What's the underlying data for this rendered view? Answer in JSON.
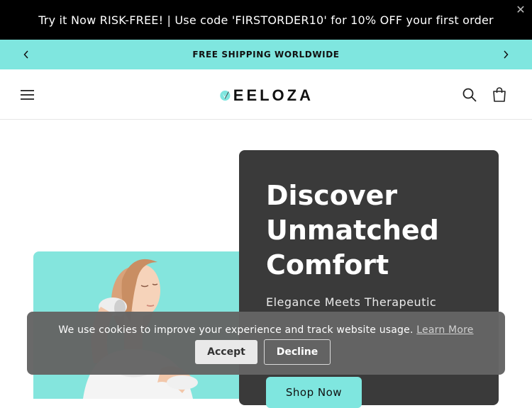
{
  "announcement": {
    "text": "Try it Now RISK-FREE! | Use code 'FIRSTORDER10' for 10% OFF your first order",
    "close_icon": "close-icon"
  },
  "shipping_bar": {
    "text": "FREE SHIPPING WORLDWIDE",
    "prev_icon": "chevron-left-icon",
    "next_icon": "chevron-right-icon"
  },
  "header": {
    "menu_icon": "hamburger-menu-icon",
    "logo_text": "EELOZA",
    "search_icon": "search-icon",
    "cart_icon": "shopping-bag-icon"
  },
  "hero": {
    "title": "Discover Unmatched Comfort",
    "subtitle": "Elegance Meets Therapeutic",
    "cta_label": "Shop Now"
  },
  "cookie_banner": {
    "message": "We use cookies to improve your experience and track website usage.",
    "learn_more": "Learn More",
    "accept_label": "Accept",
    "decline_label": "Decline"
  },
  "colors": {
    "accent": "#7fe6df",
    "hero_card": "#3a3a3a",
    "promo_bg": "#000000",
    "cookie_bg": "#646464"
  }
}
